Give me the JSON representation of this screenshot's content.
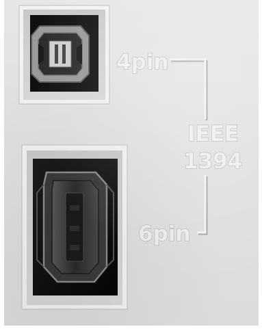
{
  "labels": {
    "four_pin": "4pin",
    "standard_line1": "IEEE",
    "standard_line2": "1394",
    "six_pin": "6pin"
  },
  "colors": {
    "panel": "#e0e0e0",
    "port_hole": "#0d0d0d",
    "label_fill": "#eeeeee"
  }
}
